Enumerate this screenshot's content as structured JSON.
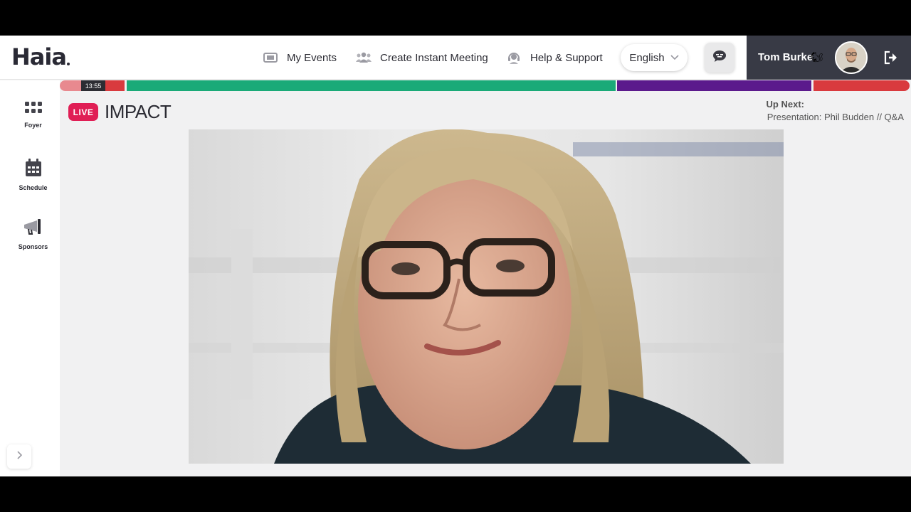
{
  "header": {
    "logo_text": "Haia",
    "nav": [
      {
        "label": "My Events",
        "icon": "ticket-icon"
      },
      {
        "label": "Create Instant Meeting",
        "icon": "people-icon"
      },
      {
        "label": "Help & Support",
        "icon": "headset-icon"
      }
    ],
    "language": {
      "label": "English",
      "icon": "chevron-down-icon"
    },
    "chat_icon": "chat-bubble-icon",
    "user": {
      "name": "Tom Burke",
      "emoji": "🐿",
      "avatar_icon": "avatar-icon",
      "logout_icon": "logout-icon"
    }
  },
  "sidebar": {
    "items": [
      {
        "label": "Foyer",
        "icon": "grid-icon"
      },
      {
        "label": "Schedule",
        "icon": "calendar-icon"
      },
      {
        "label": "Sponsors",
        "icon": "megaphone-icon"
      }
    ],
    "collapse_icon": "chevron-right-icon"
  },
  "timeline": {
    "current_time": "13:55",
    "colors": [
      "#e8898f",
      "#1aaa78",
      "#5b1a8c",
      "#d93a3e"
    ]
  },
  "session": {
    "live_badge": "LIVE",
    "title": "IMPACT",
    "up_next_label": "Up Next:",
    "up_next_title": "Presentation: Phil Budden // Q&A"
  },
  "video": {
    "description_icon": "video-stream"
  }
}
